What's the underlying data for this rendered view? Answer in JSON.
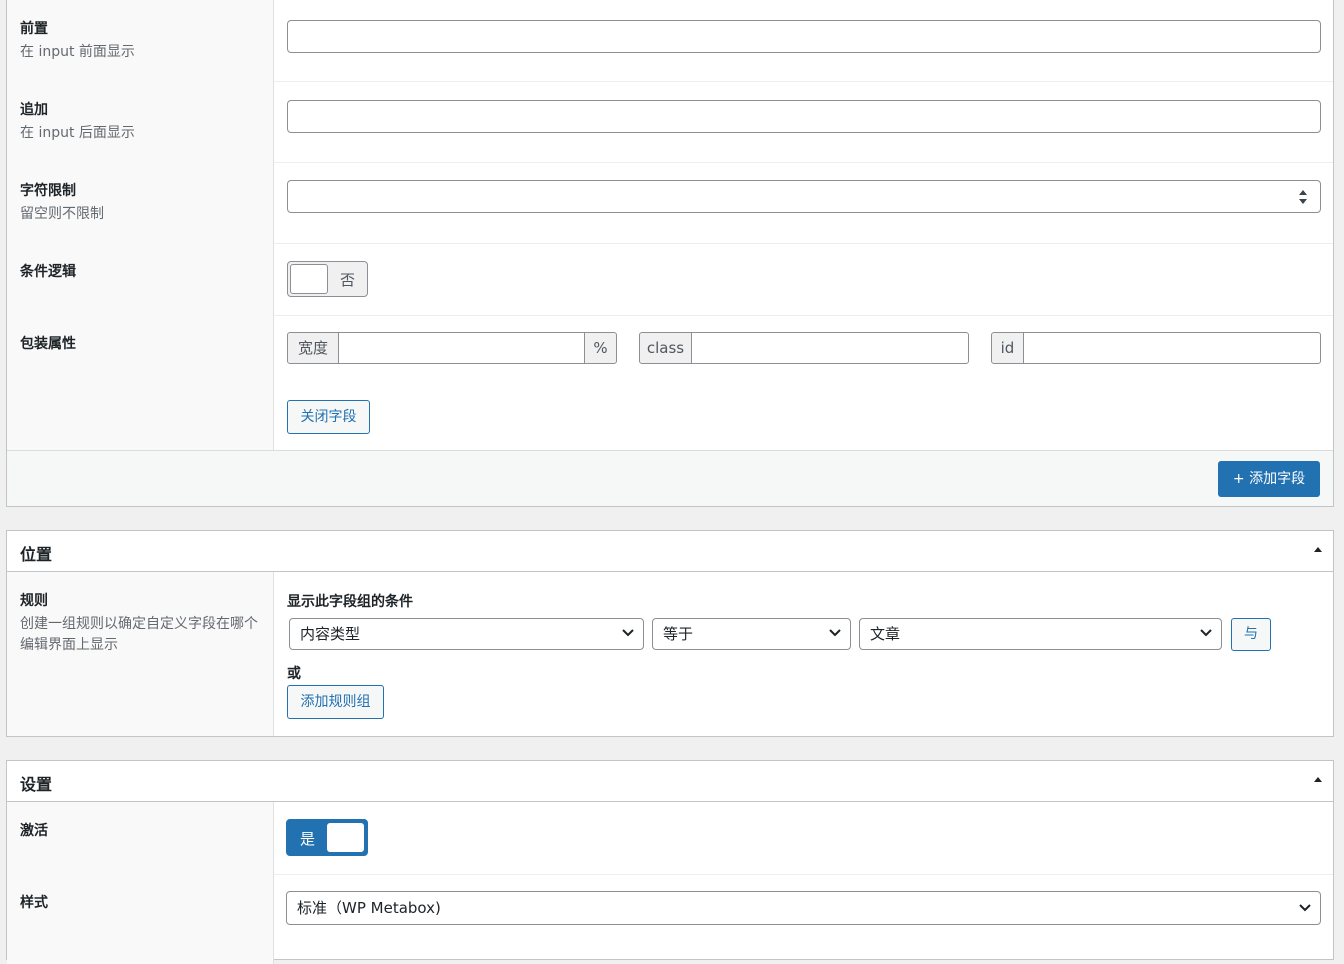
{
  "fields": {
    "prepend": {
      "label": "前置",
      "desc": "在 input 前面显示",
      "value": ""
    },
    "append": {
      "label": "追加",
      "desc": "在 input 后面显示",
      "value": ""
    },
    "char_limit": {
      "label": "字符限制",
      "desc": "留空则不限制",
      "value": ""
    },
    "conditional_logic": {
      "label": "条件逻辑",
      "toggle_text": "否",
      "state": "off"
    },
    "wrapper": {
      "label": "包装属性",
      "width_prefix": "宽度",
      "width_suffix": "%",
      "width_value": "",
      "class_prefix": "class",
      "class_value": "",
      "id_prefix": "id",
      "id_value": ""
    },
    "close_button": "关闭字段"
  },
  "add_field_button": "+ 添加字段",
  "location": {
    "title": "位置",
    "rules_label": "规则",
    "rules_desc": "创建一组规则以确定自定义字段在哪个编辑界面上显示",
    "conditions_title": "显示此字段组的条件",
    "param_select": "内容类型",
    "operator_select": "等于",
    "value_select": "文章",
    "and_button": "与",
    "or_label": "或",
    "add_rule_group_button": "添加规则组"
  },
  "settings": {
    "title": "设置",
    "active_label": "激活",
    "active_toggle_text": "是",
    "active_state": "on",
    "style_label": "样式",
    "style_select": "标准（WP Metabox)"
  },
  "colors": {
    "primary": "#2271b1",
    "border": "#c3c4c7",
    "label_bg": "#f9f9f9"
  }
}
